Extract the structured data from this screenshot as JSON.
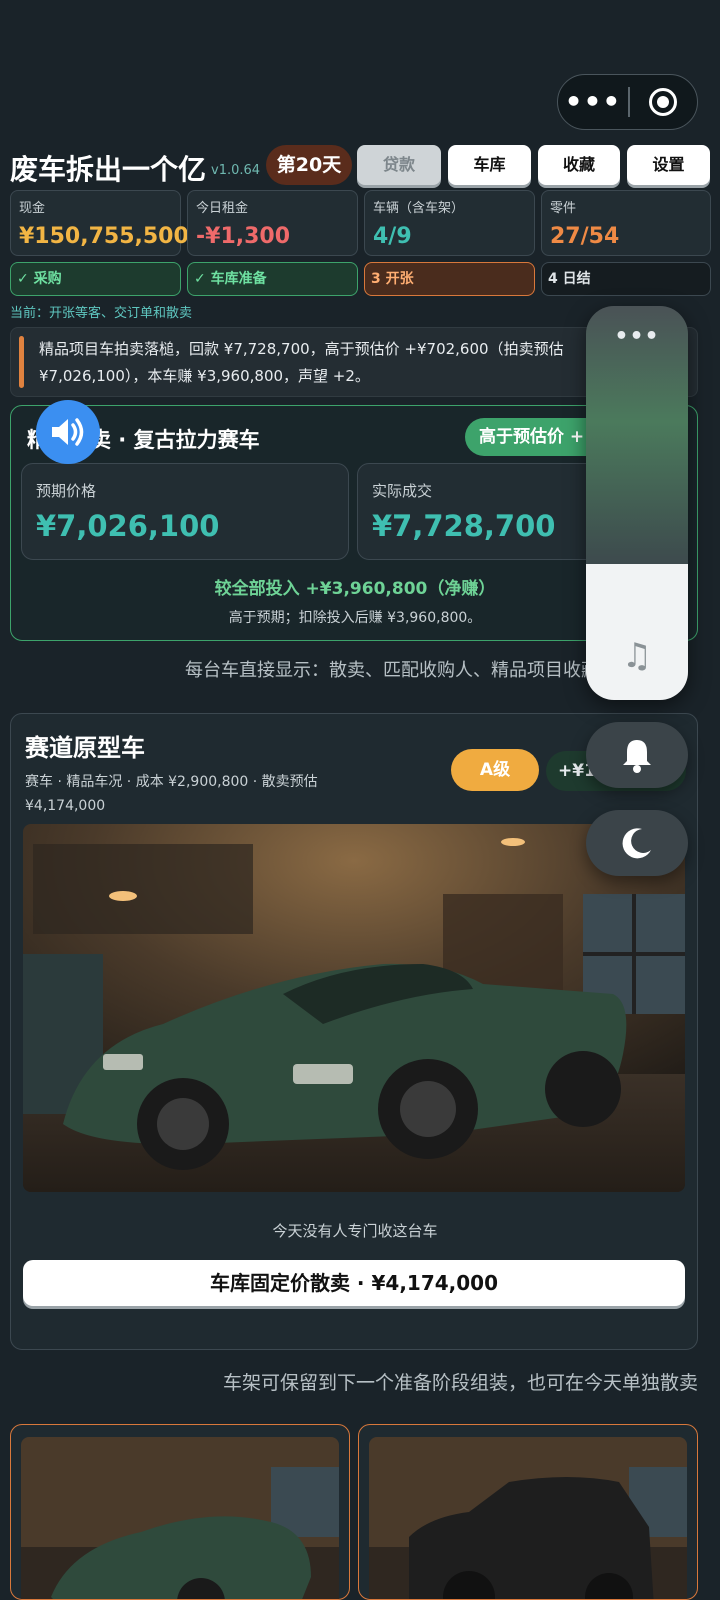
{
  "app": {
    "title": "废车拆出一个亿",
    "version": "v1.0.64",
    "day": "第20天"
  },
  "top_buttons": {
    "loan": "贷款",
    "garage": "车库",
    "favorites": "收藏",
    "settings": "设置"
  },
  "stats": [
    {
      "label": "现金",
      "value": "¥150,755,500",
      "color": "#f2b544"
    },
    {
      "label": "今日租金",
      "value": "-¥1,300",
      "color": "#ef6a6a"
    },
    {
      "label": "车辆（含车架）",
      "value": "4/9",
      "color": "#3fbfb1"
    },
    {
      "label": "零件",
      "value": "27/54",
      "color": "#ef8a45"
    }
  ],
  "steps": [
    {
      "label": "✓ 采购",
      "state": "done"
    },
    {
      "label": "✓ 车库准备",
      "state": "done"
    },
    {
      "label": "3 开张",
      "state": "active"
    },
    {
      "label": "4 日结",
      "state": "todo"
    }
  ],
  "current_phase": "当前：开张等客、交订单和散卖",
  "notice": "精品项目车拍卖落槌，回款 ¥7,728,700，高于预估价 +¥702,600（拍卖预估 ¥7,026,100），本车赚 ¥3,960,800，声望 +2。",
  "auction_result": {
    "heading": "精品拍卖 · 复古拉力赛车",
    "chip": "高于预估价 +¥702,600",
    "expected_label": "预期价格",
    "expected_value": "¥7,026,100",
    "actual_label": "实际成交",
    "actual_value": "¥7,728,700",
    "net": "较全部投入 +¥3,960,800（净赚）",
    "note": "高于预期；扣除投入后赚 ¥3,960,800。"
  },
  "hint_direct": "每台车直接显示：散卖、匹配收购人、精品项目收藏",
  "car_card": {
    "name": "赛道原型车",
    "meta": "赛车 · 精品车况 · 成本 ¥2,900,800 · 散卖预估 ¥4,174,000",
    "grade": "A级",
    "profit": "+¥1,273,200",
    "no_buyer": "今天没有人专门收这台车",
    "sell_button": "车库固定价散卖 · ¥4,174,000"
  },
  "hint_frame": "车架可保留到下一个准备阶段组装，也可在今天单独散卖",
  "overlay": {
    "more": "•••",
    "capsule_more": "•••"
  },
  "icons": [
    "more-dots-icon",
    "target-icon",
    "speaker-icon",
    "music-note-icon",
    "bell-icon",
    "moon-icon"
  ]
}
